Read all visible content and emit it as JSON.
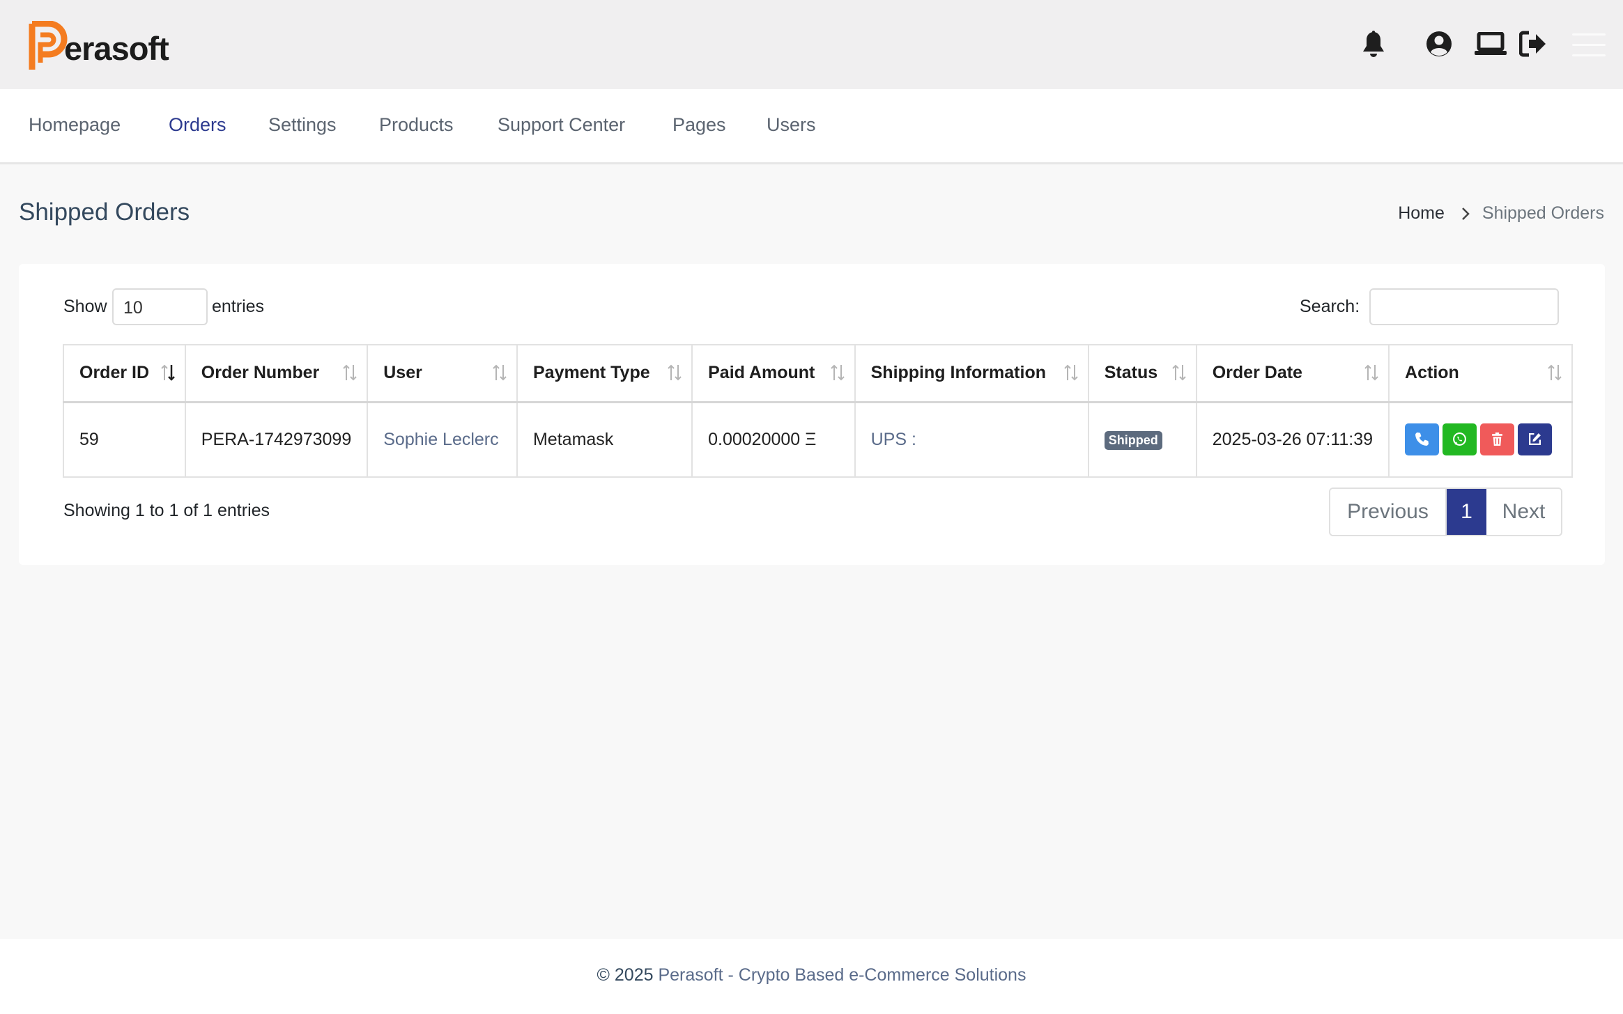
{
  "app": {
    "brand": "erasoft",
    "brand_colors": {
      "logo_orange": "#f47c20",
      "accent": "#2c3a8f"
    }
  },
  "header": {
    "icons": [
      "bell-icon",
      "user-circle-icon",
      "laptop-icon",
      "sign-out-icon",
      "hamburger-menu-icon"
    ]
  },
  "nav": {
    "items": [
      {
        "label": "Homepage"
      },
      {
        "label": "Orders",
        "active": true
      },
      {
        "label": "Settings"
      },
      {
        "label": "Products"
      },
      {
        "label": "Support Center"
      },
      {
        "label": "Pages"
      },
      {
        "label": "Users"
      }
    ]
  },
  "page": {
    "title": "Shipped Orders",
    "breadcrumb": {
      "home": "Home",
      "current": "Shipped Orders"
    }
  },
  "table_controls": {
    "show_label": "Show",
    "entries_value": "10",
    "entries_label": "entries",
    "search_label": "Search:",
    "search_value": ""
  },
  "table": {
    "columns": [
      "Order ID",
      "Order Number",
      "User",
      "Payment Type",
      "Paid Amount",
      "Shipping Information",
      "Status",
      "Order Date",
      "Action"
    ],
    "rows": [
      {
        "order_id": "59",
        "order_number": "PERA-1742973099",
        "user": "Sophie Leclerc",
        "payment_type": "Metamask",
        "paid_amount": "0.00020000 Ξ",
        "shipping_information": "UPS :",
        "status": "Shipped",
        "order_date": "2025-03-26 07:11:39",
        "actions": [
          {
            "icon": "phone-icon",
            "color": "#3d8fe8"
          },
          {
            "icon": "whatsapp-icon",
            "color": "#22b822"
          },
          {
            "icon": "trash-icon",
            "color": "#f05a5a"
          },
          {
            "icon": "edit-icon",
            "color": "#2c3a8f"
          }
        ]
      }
    ]
  },
  "pagination": {
    "info": "Showing 1 to 1 of 1 entries",
    "previous": "Previous",
    "current_page": "1",
    "next": "Next"
  },
  "footer": {
    "copyright": "© 2025",
    "text": "Perasoft - Crypto Based e-Commerce Solutions"
  }
}
